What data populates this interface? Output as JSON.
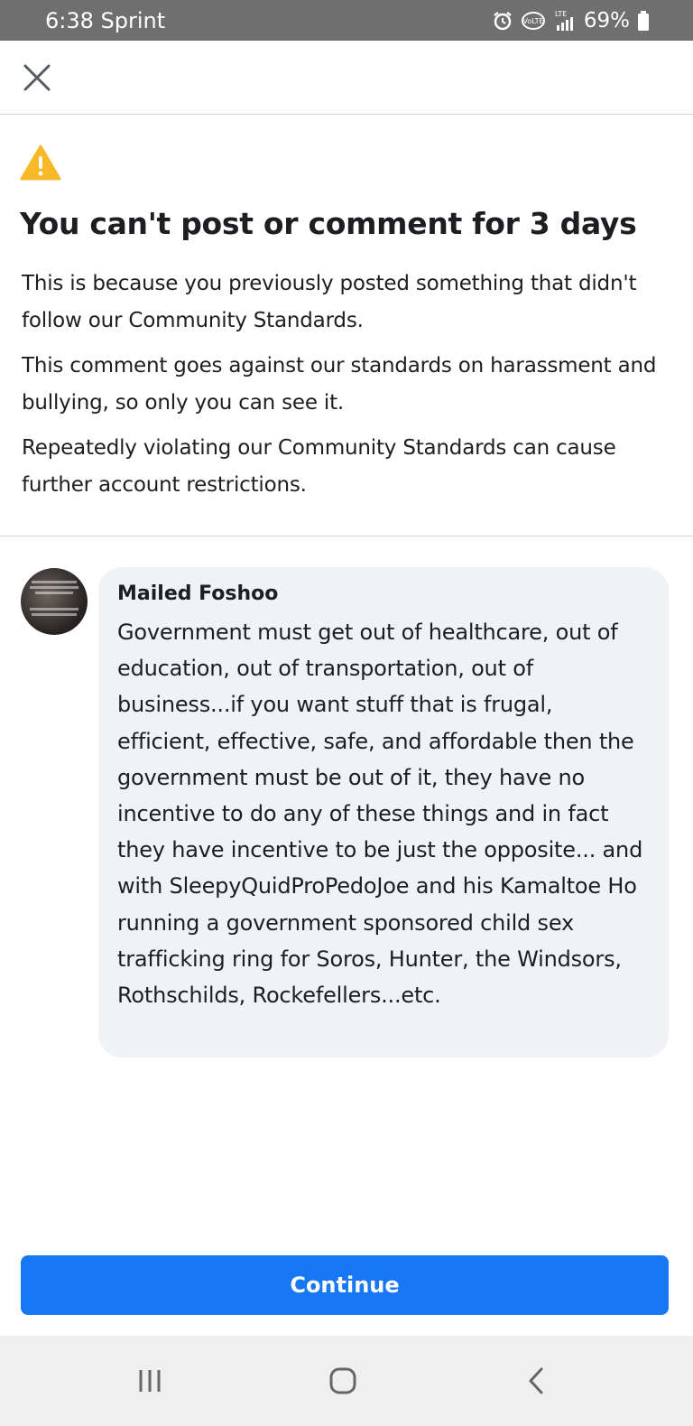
{
  "status_bar": {
    "time_carrier": "6:38 Sprint",
    "battery": "69%",
    "icons": [
      "alarm-icon",
      "volte-icon",
      "lte-signal-icon",
      "battery-icon"
    ]
  },
  "header": {
    "close_icon": "close-icon"
  },
  "notice": {
    "icon": "warning-icon",
    "accent_color": "#f7b928",
    "title": "You can't post or comment for 3 days",
    "paragraphs": [
      "This is because you previously posted something that didn't follow our Community Standards.",
      "This comment goes against our standards on harassment and bullying, so only you can see it.",
      "Repeatedly violating our Community Standards can cause further account restrictions."
    ]
  },
  "comment": {
    "author": "Mailed Foshoo",
    "text": "Government must get out of healthcare, out of education, out of transportation, out of business...if you want stuff that is frugal, efficient, effective, safe, and affordable then the government must be out of it, they have no incentive to do any of these things and in fact they have incentive to be just the opposite... and with SleepyQuidProPedoJoe and his Kamaltoe Ho running a government sponsored child sex trafficking ring for Soros, Hunter, the Windsors, Rothschilds, Rockefellers...etc."
  },
  "footer": {
    "continue_label": "Continue",
    "button_color": "#1877f2"
  },
  "nav_bar": {
    "icons": [
      "recent-apps-icon",
      "home-icon",
      "back-icon"
    ]
  }
}
